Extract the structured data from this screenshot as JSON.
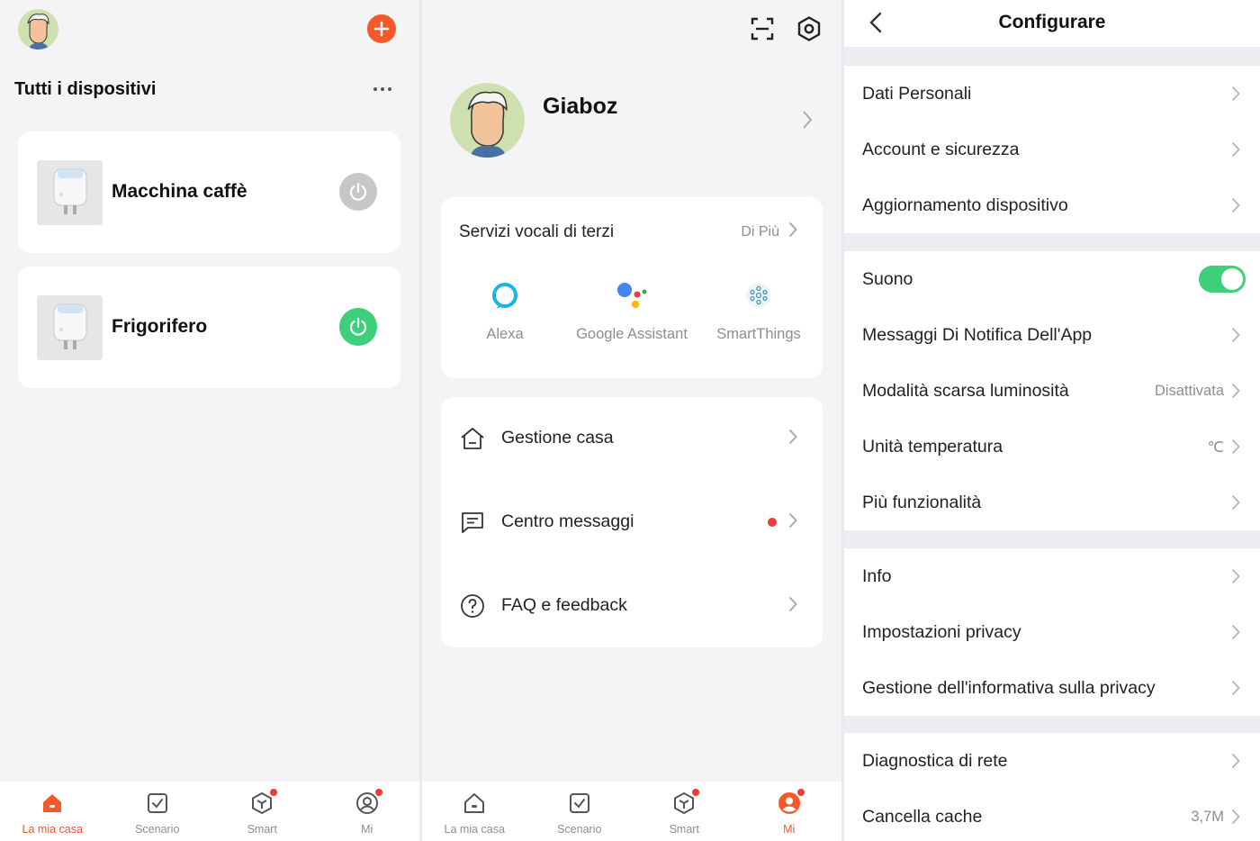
{
  "colors": {
    "accent": "#f4592a",
    "on": "#3dcf7a",
    "off": "#c7c7c7",
    "badge": "#f03a3a"
  },
  "home": {
    "title": "Tutti i dispositivi",
    "devices": [
      {
        "name": "Macchina caffè",
        "power": "off"
      },
      {
        "name": "Frigorifero",
        "power": "on"
      }
    ]
  },
  "nav": {
    "items": [
      {
        "label": "La mia casa",
        "icon": "home-icon"
      },
      {
        "label": "Scenario",
        "icon": "scenario-icon"
      },
      {
        "label": "Smart",
        "icon": "smart-icon"
      },
      {
        "label": "Mi",
        "icon": "profile-icon"
      }
    ]
  },
  "profile": {
    "username": "Giaboz",
    "voice": {
      "header": "Servizi vocali di terzi",
      "more": "Di Più",
      "services": [
        {
          "label": "Alexa",
          "icon": "alexa-icon"
        },
        {
          "label": "Google Assistant",
          "icon": "google-assistant-icon"
        },
        {
          "label": "SmartThings",
          "icon": "smartthings-icon"
        }
      ]
    },
    "menu": [
      {
        "label": "Gestione casa",
        "icon": "house-icon"
      },
      {
        "label": "Centro messaggi",
        "icon": "message-icon"
      },
      {
        "label": "FAQ e feedback",
        "icon": "help-icon"
      }
    ]
  },
  "settings": {
    "title": "Configurare",
    "groups": [
      [
        {
          "label": "Dati Personali"
        },
        {
          "label": "Account e sicurezza"
        },
        {
          "label": "Aggiornamento dispositivo"
        }
      ],
      [
        {
          "label": "Suono",
          "toggle": true
        },
        {
          "label": "Messaggi Di Notifica Dell'App"
        },
        {
          "label": "Modalità scarsa luminosità",
          "value": "Disattivata"
        },
        {
          "label": "Unità temperatura",
          "value": "℃"
        },
        {
          "label": "Più funzionalità"
        }
      ],
      [
        {
          "label": "Info"
        },
        {
          "label": "Impostazioni privacy"
        },
        {
          "label": "Gestione dell'informativa sulla privacy"
        }
      ],
      [
        {
          "label": "Diagnostica di rete"
        },
        {
          "label": "Cancella cache",
          "value": "3,7M"
        }
      ]
    ]
  }
}
